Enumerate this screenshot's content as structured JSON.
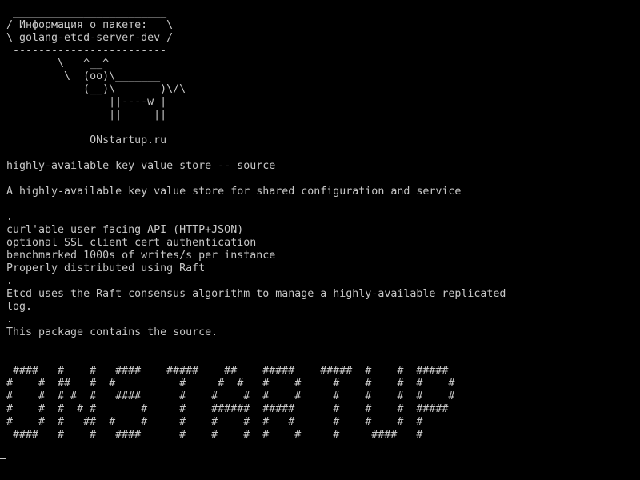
{
  "terminal": {
    "banner": [
      " ________________________",
      "/ Информация о пакете:   \\",
      "\\ golang-etcd-server-dev /",
      " ------------------------",
      "        \\   ^__^",
      "         \\  (oo)\\_______",
      "            (__)\\       )\\/\\",
      "                ||----w |",
      "                ||     ||"
    ],
    "site": "             ONstartup.ru",
    "summary": "highly-available key value store -- source",
    "description": "A highly-available key value store for shared configuration and service",
    "details": [
      ".",
      "curl'able user facing API (HTTP+JSON)",
      "optional SSL client cert authentication",
      "benchmarked 1000s of writes/s per instance",
      "Properly distributed using Raft",
      ".",
      "Etcd uses the Raft consensus algorithm to manage a highly-available replicated",
      "log.",
      ".",
      "This package contains the source."
    ],
    "ascii_art": [
      " ####   #    #   ####    #####    ##    #####    #####  #    #  #####",
      "#    #  ##   #  #          #     #  #   #    #     #    #    #  #    #",
      "#    #  # #  #   ####      #    #    #  #    #     #    #    #  #    #",
      "#    #  #  # #       #     #    ######  #####      #    #    #  #####",
      "#    #  #   ##  #    #     #    #    #  #   #      #    #    #  #",
      " ####   #    #   ####      #    #    #  #    #     #     ####   #"
    ]
  },
  "colors": {
    "background": "#000000",
    "foreground": "#c8c8c8"
  }
}
